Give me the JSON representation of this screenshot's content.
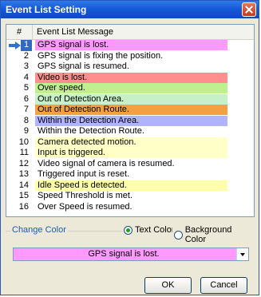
{
  "window": {
    "title": "Event List Setting"
  },
  "list": {
    "header_num": "#",
    "header_msg": "Event List Message",
    "rows": [
      {
        "num": "1",
        "msg": "GPS signal is lost.",
        "bg": "#ff99ff",
        "selected": true
      },
      {
        "num": "2",
        "msg": "GPS signal is fixing the position.",
        "bg": "#ffffff"
      },
      {
        "num": "3",
        "msg": "GPS signal is resumed.",
        "bg": "#ffffff"
      },
      {
        "num": "4",
        "msg": "Video is lost.",
        "bg": "#ff8f8f"
      },
      {
        "num": "5",
        "msg": "Over speed.",
        "bg": "#bff08f"
      },
      {
        "num": "6",
        "msg": "Out of Detection Area.",
        "bg": "#c8f0c8"
      },
      {
        "num": "7",
        "msg": "Out of Detection Route.",
        "bg": "#f5a040"
      },
      {
        "num": "8",
        "msg": "Within the Detection Area.",
        "bg": "#b0b4ff"
      },
      {
        "num": "9",
        "msg": "Within the Detection Route.",
        "bg": "#ffffff"
      },
      {
        "num": "10",
        "msg": "Camera detected motion.",
        "bg": "#ffffc8"
      },
      {
        "num": "11",
        "msg": "Input is triggered.",
        "bg": "#ffffc8"
      },
      {
        "num": "12",
        "msg": "Video signal of camera is resumed.",
        "bg": "#ffffff"
      },
      {
        "num": "13",
        "msg": "Triggered input is reset.",
        "bg": "#ffffff"
      },
      {
        "num": "14",
        "msg": "Idle Speed is detected.",
        "bg": "#ffffaa"
      },
      {
        "num": "15",
        "msg": "Speed Threshold is met.",
        "bg": "#ffffff"
      },
      {
        "num": "16",
        "msg": "Over Speed is resumed.",
        "bg": "#ffffff"
      }
    ]
  },
  "color": {
    "label": "Change Color",
    "text_color": "Text Color",
    "background_color": "Background Color",
    "selected": "text",
    "dropdown_value": "GPS signal is lost.",
    "dropdown_bg": "#ff99ff"
  },
  "buttons": {
    "ok": "OK",
    "cancel": "Cancel"
  }
}
